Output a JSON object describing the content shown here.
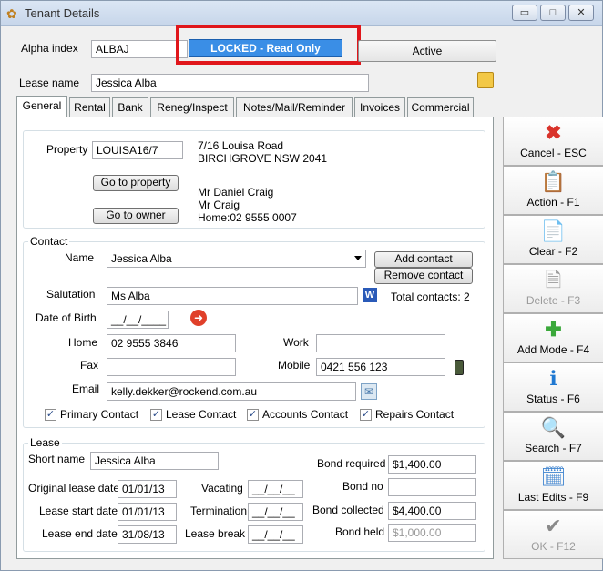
{
  "window": {
    "title": "Tenant Details",
    "buttons": [
      "▭",
      "□",
      "✕"
    ]
  },
  "header": {
    "alpha_label": "Alpha index",
    "alpha_value": "ALBAJ",
    "locked_label": "LOCKED - Read Only",
    "status_label": "Active",
    "lease_name_label": "Lease name",
    "lease_name_value": "Jessica Alba"
  },
  "tabs": [
    "General",
    "Rental",
    "Bank",
    "Reneg/Inspect",
    "Notes/Mail/Reminder",
    "Invoices",
    "Commercial"
  ],
  "property": {
    "label": "Property",
    "code": "LOUISA16/7",
    "address1": "7/16 Louisa Road",
    "address2": "BIRCHGROVE  NSW  2041",
    "go_property": "Go to property",
    "go_owner": "Go to owner",
    "owner1": "Mr Daniel Craig",
    "owner2": "Mr Craig",
    "owner3": "Home:02 9555 0007"
  },
  "contact": {
    "legend": "Contact",
    "name_label": "Name",
    "name_value": "Jessica Alba",
    "add_contact": "Add contact",
    "remove_contact": "Remove contact",
    "salutation_label": "Salutation",
    "salutation_value": "Ms Alba",
    "total_contacts": "Total contacts: 2",
    "dob_label": "Date of Birth",
    "dob_value": "__/__/____",
    "home_label": "Home",
    "home_value": "02 9555 3846",
    "work_label": "Work",
    "work_value": "",
    "fax_label": "Fax",
    "fax_value": "",
    "mobile_label": "Mobile",
    "mobile_value": "0421 556 123",
    "email_label": "Email",
    "email_value": "kelly.dekker@rockend.com.au",
    "checks": [
      "Primary Contact",
      "Lease Contact",
      "Accounts Contact",
      "Repairs Contact"
    ]
  },
  "lease": {
    "legend": "Lease",
    "short_name_label": "Short name",
    "short_name_value": "Jessica Alba",
    "bond_required_label": "Bond required",
    "bond_required_value": "$1,400.00",
    "original_label": "Original lease date",
    "original_value": "01/01/13",
    "vacating_label": "Vacating",
    "vacating_value": "__/__/__",
    "bond_no_label": "Bond no",
    "bond_no_value": "",
    "start_label": "Lease start date",
    "start_value": "01/01/13",
    "termination_label": "Termination",
    "termination_value": "__/__/__",
    "bond_collected_label": "Bond collected",
    "bond_collected_value": "$4,400.00",
    "end_label": "Lease end date",
    "end_value": "31/08/13",
    "break_label": "Lease break",
    "break_value": "__/__/__",
    "bond_held_label": "Bond held",
    "bond_held_value": "$1,000.00"
  },
  "sidebar": [
    {
      "label": "Cancel - ESC",
      "icon": "✖"
    },
    {
      "label": "Action - F1",
      "icon": "📋"
    },
    {
      "label": "Clear - F2",
      "icon": "📄"
    },
    {
      "label": "Delete - F3",
      "icon": "🗎"
    },
    {
      "label": "Add Mode - F4",
      "icon": "✚"
    },
    {
      "label": "Status - F6",
      "icon": "ℹ"
    },
    {
      "label": "Search - F7",
      "icon": "🔍"
    },
    {
      "label": "Last Edits - F9",
      "icon": "🗓"
    },
    {
      "label": "OK - F12",
      "icon": "✔"
    }
  ]
}
